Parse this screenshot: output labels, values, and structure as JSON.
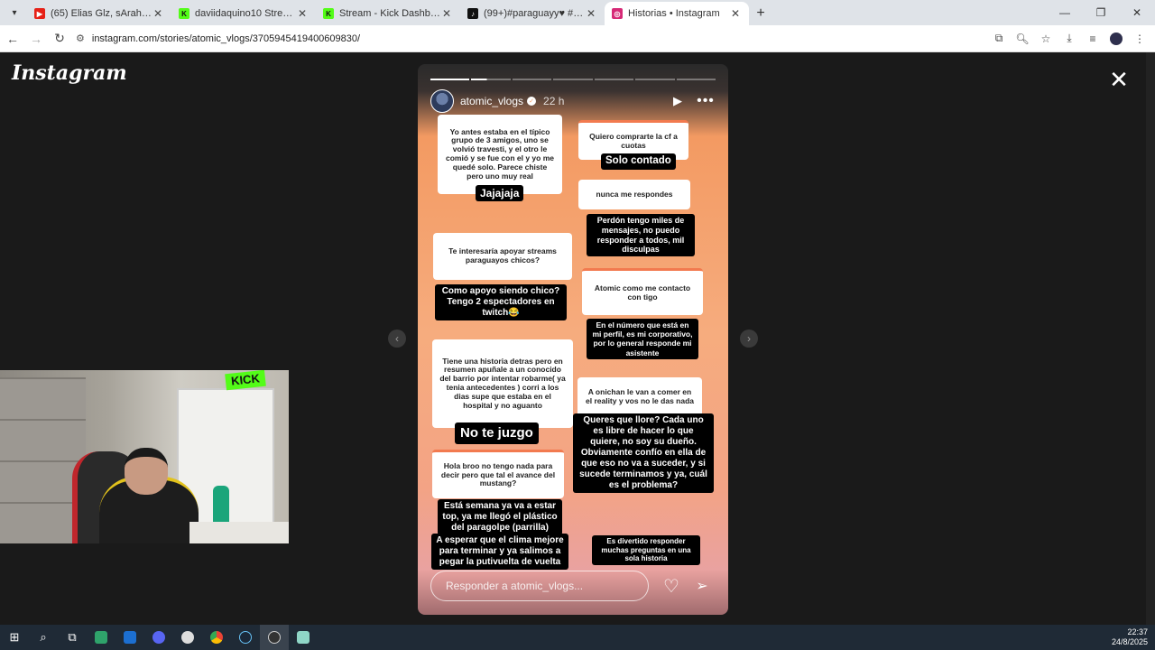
{
  "browser": {
    "tabs": [
      {
        "title": "(65) Elias Glz, sArah, Wave, Gala...",
        "color": "#e62117",
        "glyph": "▶",
        "active": false
      },
      {
        "title": "daviidaquino10 Stream - Watch...",
        "color": "#53fc18",
        "glyph": "K",
        "active": false
      },
      {
        "title": "Stream - Kick Dashboard",
        "color": "#53fc18",
        "glyph": "K",
        "active": false
      },
      {
        "title": "(99+)#paraguayy♥ #albirroja...",
        "color": "#111111",
        "glyph": "♪",
        "active": false
      },
      {
        "title": "Historias • Instagram",
        "color": "#d62976",
        "glyph": "◎",
        "active": true
      }
    ],
    "url": "instagram.com/stories/atomic_vlogs/3705945419400609830/"
  },
  "instagram": {
    "logo": "Instagram",
    "story": {
      "username": "atomic_vlogs",
      "time": "22 h",
      "reply_placeholder": "Responder a atomic_vlogs...",
      "progress": {
        "segments": 7,
        "done": 1,
        "current_fraction": 0.4
      }
    },
    "questions": [
      {
        "q": "Yo antes estaba en el típico grupo de 3 amigos, uno se volvió travesti, y el otro le comió y se fue con el y yo me quedé solo. Parece chiste pero uno muy real",
        "a": "Jajajaja"
      },
      {
        "q": "Quiero comprarte la cf a cuotas",
        "a": "Solo contado"
      },
      {
        "q": "nunca me respondes",
        "a": "Perdón tengo miles de mensajes, no puedo responder a todos, mil disculpas"
      },
      {
        "q": "Te interesaría apoyar streams paraguayos chicos?",
        "a": "Como apoyo siendo chico? Tengo 2 espectadores en twitch😂"
      },
      {
        "q": "Atomic como me contacto con tigo",
        "a": "En el número que está en mi perfil, es mi corporativo, por lo general responde mi asistente"
      },
      {
        "q": "Tiene una historia detras pero en resumen apuñale a un conocido del barrio por intentar robarme( ya tenia antecedentes ) corri a los dias supe que estaba en el hospital y no aguanto",
        "a": "No te juzgo"
      },
      {
        "q": "A onichan le van a comer en el reality y vos no le das nada",
        "a": "Queres que llore? Cada uno es libre de hacer lo que quiere, no soy su dueño. Obviamente confío en ella de que eso no va a suceder, y si sucede terminamos y ya, cuál es el problema?"
      },
      {
        "q": "Hola broo no tengo nada para decir pero que tal el avance del mustang?",
        "a": "Está semana ya va a estar top, ya me llegó el plástico del paragolpe (parrilla)"
      },
      {
        "a2": "A esperar que el clima mejore para terminar y ya salimos a pegar la putivuelta de vuelta"
      },
      {
        "footer": "Es divertido responder muchas preguntas en una sola historia"
      }
    ]
  },
  "webcam": {
    "sign": "KICK"
  },
  "taskbar": {
    "time": "22:37",
    "date": "24/8/2025"
  }
}
